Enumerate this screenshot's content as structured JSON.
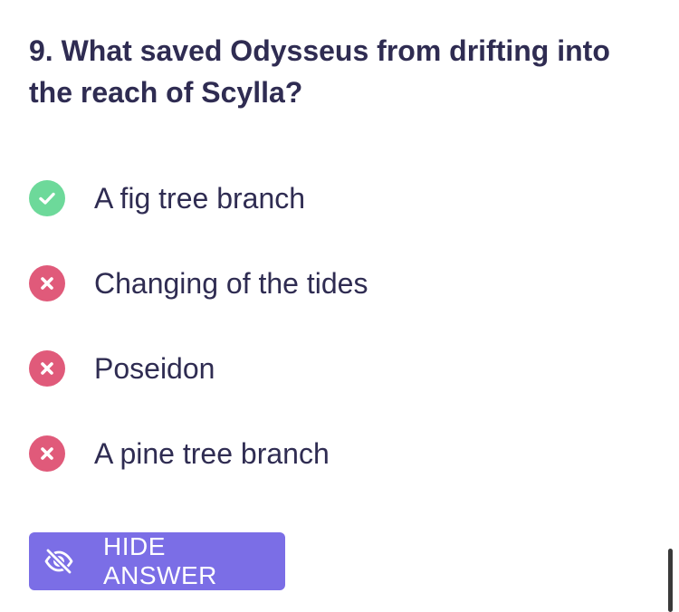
{
  "question": {
    "text": "9. What saved Odysseus from drifting into the reach of Scylla?"
  },
  "options": [
    {
      "label": "A fig tree branch",
      "status": "correct",
      "icon": "check-circle-icon",
      "color": "#6dd99a"
    },
    {
      "label": "Changing of the tides",
      "status": "incorrect",
      "icon": "x-circle-icon",
      "color": "#e05a7a"
    },
    {
      "label": "Poseidon",
      "status": "incorrect",
      "icon": "x-circle-icon",
      "color": "#e05a7a"
    },
    {
      "label": "A pine tree branch",
      "status": "incorrect",
      "icon": "x-circle-icon",
      "color": "#e05a7a"
    }
  ],
  "hide_button": {
    "label": "HIDE ANSWER",
    "icon": "eye-slash-icon",
    "color": "#7b6ee6"
  }
}
